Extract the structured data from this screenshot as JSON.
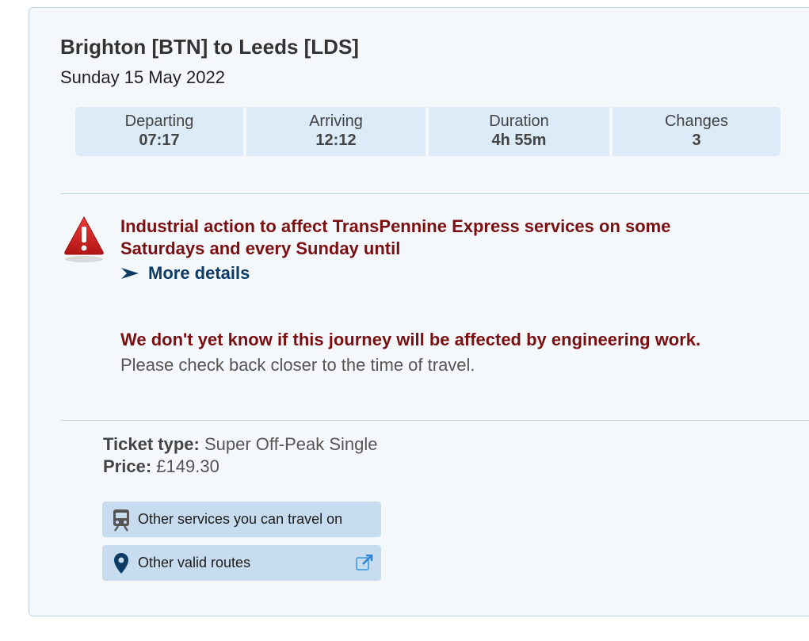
{
  "journey": {
    "title": "Brighton [BTN] to Leeds [LDS]",
    "date": "Sunday 15 May 2022"
  },
  "summary": {
    "departing_label": "Departing",
    "departing_value": "07:17",
    "arriving_label": "Arriving",
    "arriving_value": "12:12",
    "duration_label": "Duration",
    "duration_value": "4h 55m",
    "changes_label": "Changes",
    "changes_value": "3"
  },
  "alert": {
    "icon": "warning-icon",
    "title": "Industrial action to affect TransPennine Express services on some Saturdays and every Sunday until",
    "link_label": "More details"
  },
  "engineering": {
    "title": "We don't yet know if this journey will be affected by engineering work.",
    "message": "Please check back closer to the time of travel."
  },
  "ticket": {
    "type_label": "Ticket type:",
    "type_value": "Super Off-Peak Single",
    "price_label": "Price:",
    "price_value": "£149.30"
  },
  "actions": {
    "other_services_label": "Other services you can travel on",
    "other_services_icon": "train-icon",
    "other_routes_label": "Other valid routes",
    "other_routes_icon": "map-pin-icon",
    "external_icon": "external-link-icon"
  },
  "colors": {
    "panel_bg": "#f5f8fb",
    "border": "#bcd6e3",
    "summary_cell": "#dcebf7",
    "alert_text": "#7a0f12",
    "link_text": "#0c3b63",
    "button_bg": "#c7dcee"
  }
}
